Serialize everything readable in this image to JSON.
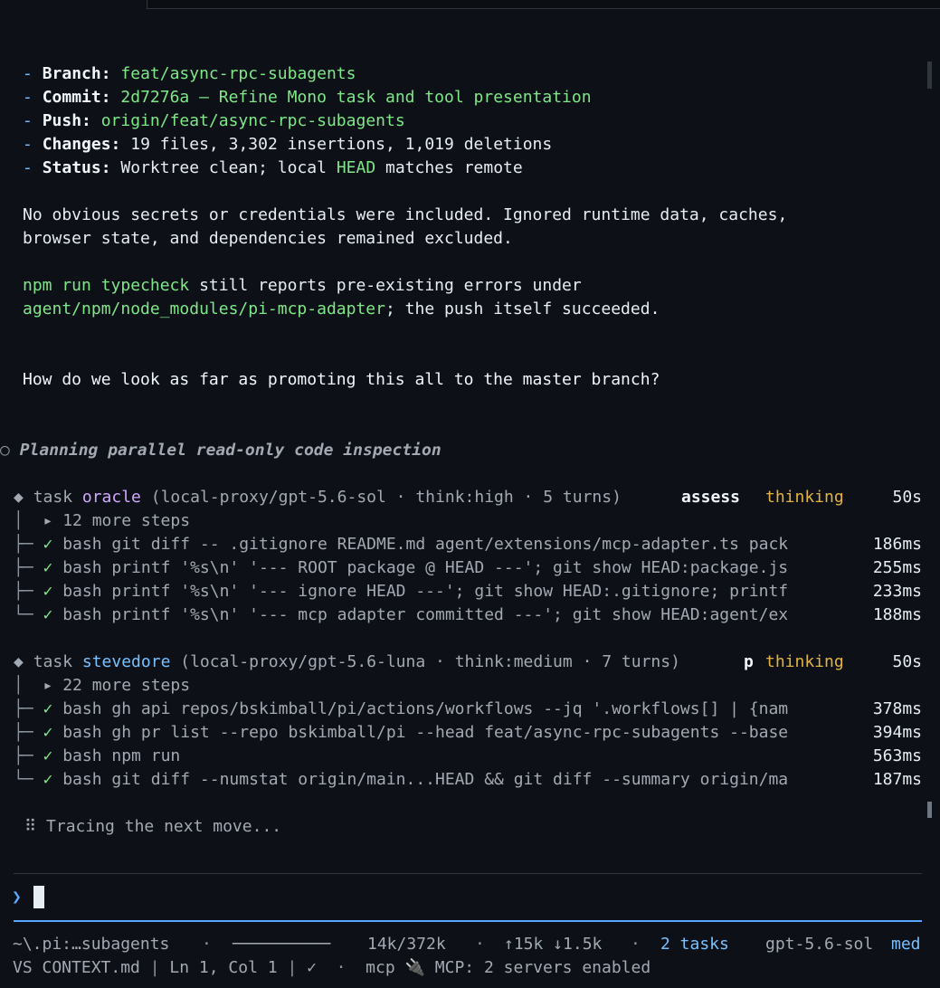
{
  "summary": {
    "branch_label": "Branch:",
    "branch_value": "feat/async-rpc-subagents",
    "commit_label": "Commit:",
    "commit_value": "2d7276a — Refine Mono task and tool presentation",
    "push_label": "Push:",
    "push_value": "origin/feat/async-rpc-subagents",
    "changes_label": "Changes:",
    "changes_value": "19 files, 3,302 insertions, 1,019 deletions",
    "status_label": "Status:",
    "status_pre": "Worktree clean; local ",
    "status_head": "HEAD",
    "status_post": " matches remote"
  },
  "notes": {
    "secrets_line1": "No obvious secrets or credentials were included. Ignored runtime data, caches,",
    "secrets_line2": "browser state, and dependencies remained excluded.",
    "typecheck_cmd": "npm run typecheck",
    "typecheck_rest": " still reports pre-existing errors under",
    "typecheck_path": "agent/npm/node_modules/pi-mcp-adapter",
    "typecheck_end": "; the push itself succeeded."
  },
  "user_question": "How do we look as far as promoting this all to the master branch?",
  "planning": "Planning parallel read-only code inspection",
  "tasks": [
    {
      "prefix": "task ",
      "name": "oracle",
      "meta": " (local-proxy/gpt-5.6-sol · think:high · 5 turns)",
      "action": "assess",
      "state": "thinking",
      "elapsed": "50s",
      "more_steps": "▸ 12 more steps",
      "steps": [
        {
          "cmd": "bash git diff -- .gitignore README.md agent/extensions/mcp-adapter.ts pack",
          "time": "186ms"
        },
        {
          "cmd": "bash printf '%s\\n' '--- ROOT package @ HEAD ---'; git show HEAD:package.js",
          "time": "255ms"
        },
        {
          "cmd": "bash printf '%s\\n' '--- ignore HEAD ---'; git show HEAD:.gitignore; printf",
          "time": "233ms"
        },
        {
          "cmd": "bash printf '%s\\n' '--- mcp adapter committed ---'; git show HEAD:agent/ex",
          "time": "188ms"
        }
      ]
    },
    {
      "prefix": "task ",
      "name": "stevedore",
      "meta": " (local-proxy/gpt-5.6-luna · think:medium · 7 turns)",
      "action": "p",
      "state": "thinking",
      "elapsed": "50s",
      "more_steps": "▸ 22 more steps",
      "steps": [
        {
          "cmd": "bash gh api repos/bskimball/pi/actions/workflows --jq '.workflows[] | {nam",
          "time": "378ms"
        },
        {
          "cmd": "bash gh pr list --repo bskimball/pi --head feat/async-rpc-subagents --base",
          "time": "394ms"
        },
        {
          "cmd": "bash npm run",
          "time": "563ms"
        },
        {
          "cmd": "bash git diff --numstat origin/main...HEAD && git diff --summary origin/ma",
          "time": "187ms"
        }
      ]
    }
  ],
  "status_spinner": "Tracing the next move...",
  "prompt": {
    "chevron": "❯",
    "value": ""
  },
  "footer": {
    "path": "~\\.pi:…subagents",
    "rule": "──────────",
    "tokens": "14k/372k",
    "io": "↑15k ↓1.5k",
    "tasks": "2 tasks",
    "model": "gpt-5.6-sol",
    "effort": "med",
    "file": "VS CONTEXT.md",
    "position": "Ln 1, Col 1",
    "check": "✓",
    "mcp": "mcp",
    "mcp_status": "MCP: 2 servers enabled"
  },
  "colors": {
    "background": "#0d1117",
    "green": "#7ee787",
    "purple": "#d2a8ff",
    "blue": "#79c0ff",
    "yellow": "#e3b341"
  }
}
